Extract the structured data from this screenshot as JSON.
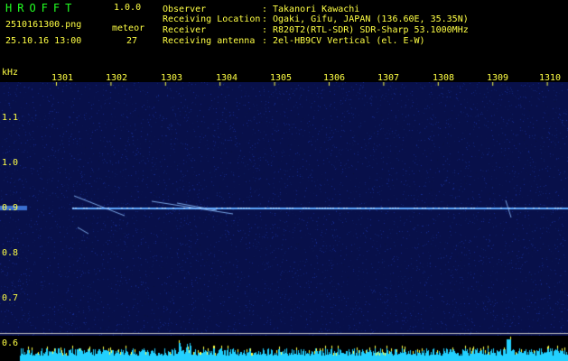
{
  "header": {
    "app_name": "HROFFT",
    "version": "1.0.0",
    "filename": "2510161300.png",
    "datetime": "25.10.16 13:00",
    "meteor_label": "meteor",
    "meteor_count": "27"
  },
  "info": [
    {
      "label": "Observer",
      "value": "Takanori Kawachi"
    },
    {
      "label": "Receiving Location",
      "value": "Ogaki, Gifu, JAPAN (136.60E, 35.35N)"
    },
    {
      "label": "Receiver",
      "value": "R820T2(RTL-SDR) SDR-Sharp 53.1000MHz"
    },
    {
      "label": "Receiving antenna",
      "value": "2el-HB9CV Vertical (el. E-W)"
    }
  ],
  "axis": {
    "y_unit": "kHz",
    "x_ticks": [
      "1301",
      "1302",
      "1303",
      "1304",
      "1305",
      "1306",
      "1307",
      "1308",
      "1309",
      "1310"
    ],
    "y_ticks": [
      "1.1",
      "1.0",
      "0.9",
      "0.8",
      "0.7",
      "0.6"
    ]
  },
  "colors": {
    "background": "#000000",
    "spectrogram_bg": "#08104a",
    "carrier": "#5fa8ff",
    "text_yellow": "#ffff44",
    "text_green": "#22ff22",
    "level_bars": "#22d0ff"
  }
}
